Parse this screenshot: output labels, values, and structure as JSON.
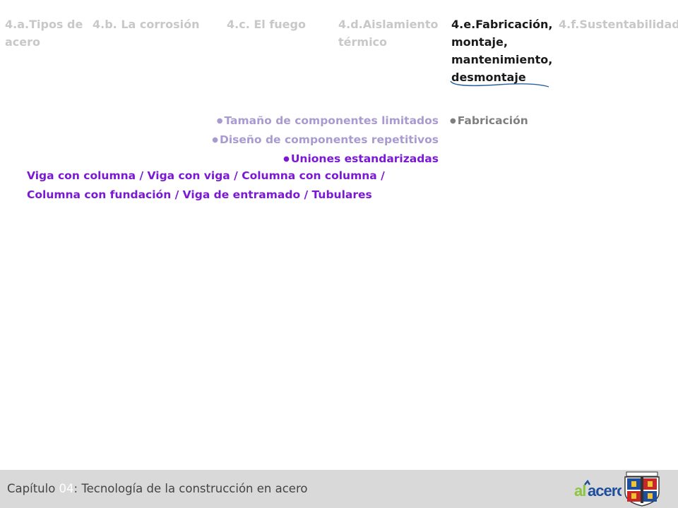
{
  "nav": {
    "tabs": [
      {
        "label": "4.a.Tipos de acero",
        "active": false
      },
      {
        "label": "4.b. La corrosión",
        "active": false
      },
      {
        "label": "4.c. El fuego",
        "active": false
      },
      {
        "label": "4.d.Aislamiento térmico",
        "active": false
      },
      {
        "label": "4.e.Fabricación, montaje, mantenimiento, desmontaje",
        "active": true
      },
      {
        "label": "4.f.Sustentabilidad",
        "active": false
      }
    ]
  },
  "content": {
    "bullets": [
      "Tamaño de componentes limitados",
      "Diseño de componentes repetitivos",
      "Uniones estandarizadas"
    ],
    "connections_line1": "Viga con columna / Viga con viga / Columna con columna /",
    "connections_line2": "Columna con fundación / Viga de entramado / Tubulares",
    "section_bullet": "Fabricación"
  },
  "footer": {
    "chapter_prefix": "Capítulo ",
    "chapter_number": "04",
    "chapter_title": ": Tecnología de la construcción en acero",
    "logo_text": "alacero"
  },
  "colors": {
    "active_tab": "#1a1a1a",
    "inactive_tab": "#c8c8c8",
    "muted_bullet": "#a99bd0",
    "highlight": "#7b18d4",
    "footer_bg": "#d9d9d9",
    "logo_green": "#8cc63f",
    "logo_blue": "#1f4e9c",
    "underline_stroke": "#2c5f9e"
  }
}
